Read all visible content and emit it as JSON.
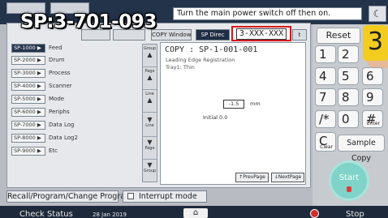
{
  "overlay": {
    "title": "SP:3-701-093"
  },
  "header": {
    "message": "Turn the main power switch off then on."
  },
  "toolbar": {
    "tab_1": "",
    "tab_2": "",
    "copy_window": "COPY Window",
    "sp_direct": "SP Direc",
    "code_input": "3-XXX-XXX",
    "exit": "t"
  },
  "sp_groups": [
    {
      "code": "SP-1000",
      "label": "Feed"
    },
    {
      "code": "SP-2000",
      "label": "Drum"
    },
    {
      "code": "SP-3000",
      "label": "Process"
    },
    {
      "code": "SP-4000",
      "label": "Scanner"
    },
    {
      "code": "SP-5000",
      "label": "Mode"
    },
    {
      "code": "SP-6000",
      "label": "Periphs"
    },
    {
      "code": "SP-7000",
      "label": "Data Log"
    },
    {
      "code": "SP-8000",
      "label": "Data Log2"
    },
    {
      "code": "SP-9000",
      "label": "Etc"
    }
  ],
  "scroll": {
    "group": "Group",
    "page": "Page",
    "line": "Line"
  },
  "detail": {
    "title": "COPY : SP-1-001-001",
    "subtitle_1": "Leading Edge Registration",
    "subtitle_2": "Tray1: Thin",
    "value": "-1.5",
    "unit": "mm",
    "initial": "Initial  0.0",
    "prev_page": "PrevPage",
    "next_page": "NextPage"
  },
  "bottom": {
    "recall": "Recall/Program/Change Program",
    "interrupt": "Interrupt mode"
  },
  "statusbar": {
    "check_status": "Check Status",
    "date": "28 Jan 2019",
    "stop": "Stop"
  },
  "keypad": {
    "reset": "Reset",
    "big_three": "3",
    "keys": [
      "1",
      "2",
      "4",
      "5",
      "6",
      "7",
      "8",
      "9",
      "/*",
      "0",
      "#"
    ],
    "enter": "Enter",
    "clear_c": "C",
    "clear": "Clear",
    "sample_copy": "Sample Copy",
    "start": "Start"
  },
  "colors": {
    "accent_dark": "#1f2d45",
    "highlight_red": "#d3191c",
    "key_yellow": "#f2cc1e",
    "start_teal": "#7fd3c8"
  }
}
